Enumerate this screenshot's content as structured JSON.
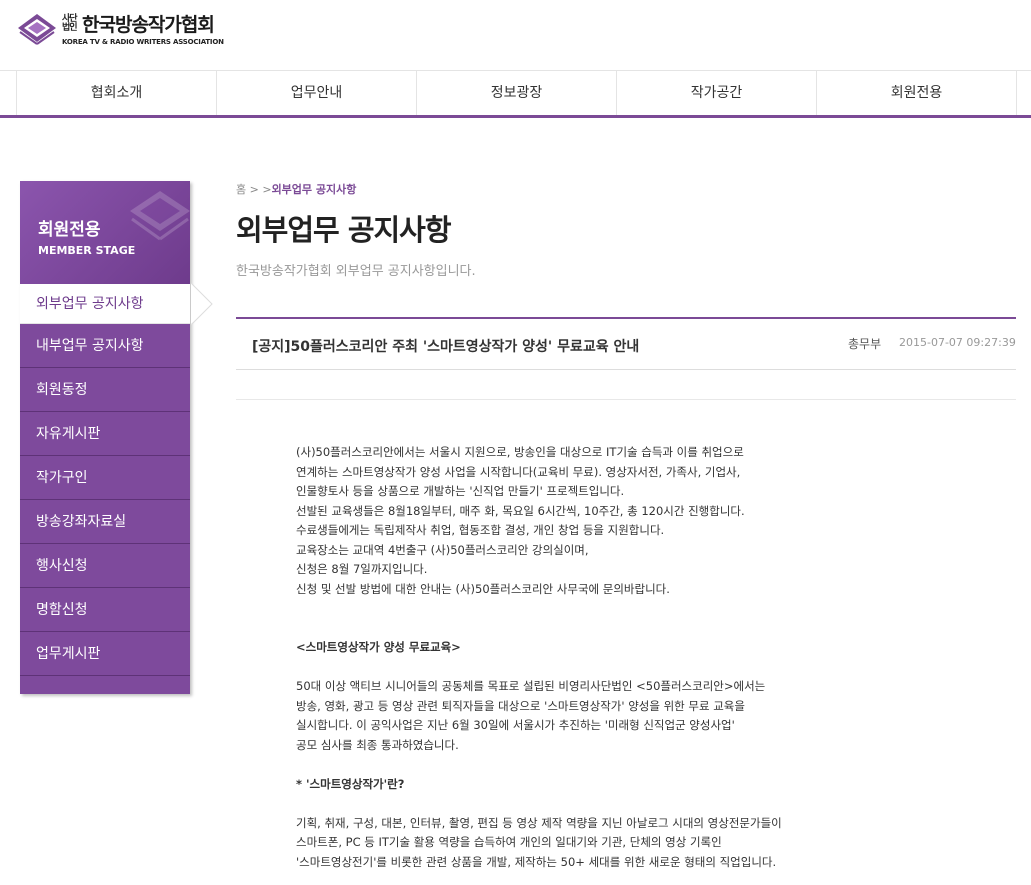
{
  "header": {
    "logo_small": "사단법인",
    "logo_title": "한국방송작가협회",
    "logo_sub": "KOREA TV & RADIO WRITERS ASSOCIATION",
    "brand_color": "#7b4a96"
  },
  "gnb": [
    {
      "label": "협회소개"
    },
    {
      "label": "업무안내"
    },
    {
      "label": "정보광장"
    },
    {
      "label": "작가공간"
    },
    {
      "label": "회원전용"
    }
  ],
  "side": {
    "title": "회원전용",
    "subtitle": "MEMBER STAGE",
    "items": [
      {
        "label": "외부업무 공지사항",
        "active": true
      },
      {
        "label": "내부업무 공지사항"
      },
      {
        "label": "회원동정"
      },
      {
        "label": "자유게시판"
      },
      {
        "label": "작가구인"
      },
      {
        "label": "방송강좌자료실"
      },
      {
        "label": "행사신청"
      },
      {
        "label": "명함신청"
      },
      {
        "label": "업무게시판"
      }
    ]
  },
  "breadcrumb": {
    "home": "홈",
    "sep1": ">",
    "sep2": ">",
    "current": "외부업무 공지사항"
  },
  "page": {
    "title": "외부업무 공지사항",
    "desc": "한국방송작가협회 외부업무 공지사항입니다."
  },
  "post": {
    "title": "[공지]50플러스코리안 주최 '스마트영상작가 양성' 무료교육 안내",
    "author": "총무부",
    "date": "2015-07-07 09:27:39",
    "body": {
      "p1": [
        "(사)50플러스코리안에서는 서울시 지원으로, 방송인을 대상으로  IT기술 습득과 이를 취업으로",
        "연계하는 스마트영상작가 양성 사업을 시작합니다(교육비 무료). 영상자서전, 가족사, 기업사,",
        "인물향토사 등을 상품으로 개발하는 '신직업 만들기' 프로젝트입니다.",
        "선발된 교육생들은 8월18일부터, 매주 화, 목요일 6시간씩, 10주간, 총 120시간 진행합니다.",
        "수료생들에게는 독립제작사 취업, 협동조합 결성, 개인 창업 등을 지원합니다.",
        "교육장소는 교대역 4번출구 (사)50플러스코리안 강의실이며,",
        "신청은 8월 7일까지입니다.",
        "신청 및 선발 방법에 대한 안내는 (사)50플러스코리안 사무국에 문의바랍니다."
      ],
      "h1": "<스마트영상작가 양성 무료교육>",
      "p2": [
        "50대 이상 액티브 시니어들의 공동체를 목표로 설립된 비영리사단법인 <50플러스코리안>에서는",
        "방송, 영화, 광고 등 영상 관련 퇴직자들을 대상으로 '스마트영상작가' 양성을 위한 무료 교육을",
        "실시합니다. 이 공익사업은 지난 6월 30일에 서울시가 추진하는 '미래형 신직업군 양성사업'",
        "공모 심사를 최종 통과하였습니다."
      ],
      "h2": "* '스마트영상작가'란?",
      "p3": [
        "기획, 취재, 구성, 대본, 인터뷰, 촬영, 편집 등 영상 제작 역량을 지닌 아날로그 시대의 영상전문가들이",
        "스마트폰, PC 등 IT기술 활용 역량을 습득하여 개인의 일대기와 기관, 단체의 영상 기록인",
        "'스마트영상전기'를 비롯한 관련 상품을 개발, 제작하는 50+ 세대를 위한 새로운 형태의 직업입니다."
      ]
    }
  }
}
